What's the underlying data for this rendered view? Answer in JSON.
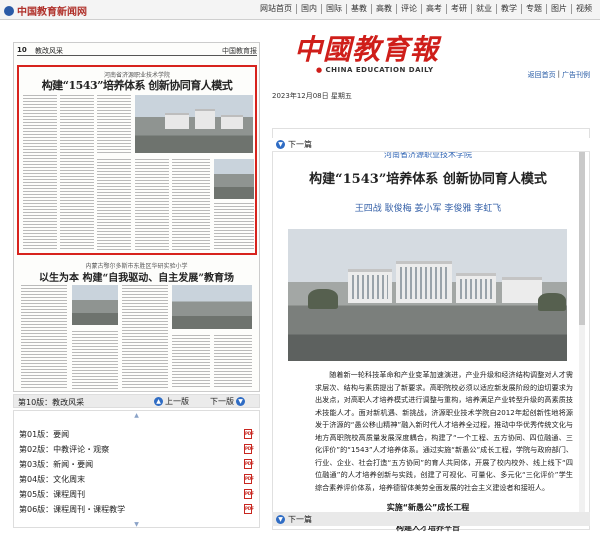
{
  "site": {
    "logo_text": "中国教育新闻网"
  },
  "nav": {
    "items": [
      "网站首页",
      "国内",
      "国际",
      "基教",
      "高教",
      "评论",
      "高考",
      "考研",
      "就业",
      "教学",
      "专题",
      "图片",
      "视频"
    ]
  },
  "paper_thumb": {
    "page_num": "10",
    "section": "教改风采",
    "brand": "中国教育报",
    "article1_pre": "河南省济源职业技术学院",
    "article1_title": "构建“1543”培养体系  创新协同育人模式",
    "article2_pre": "内蒙古鄂尔多斯市东胜区华研实验小学",
    "article2_title": "以生为本  构建“自我驱动、自主发展”教育场"
  },
  "current_page": {
    "label": "第10版：教改风采",
    "prev": "上一版",
    "next": "下一版"
  },
  "page_list": [
    {
      "label": "第01版：要闻"
    },
    {
      "label": "第02版：中教评论・观察"
    },
    {
      "label": "第03版：新闻・要闻"
    },
    {
      "label": "第04版：文化周末"
    },
    {
      "label": "第05版：课程周刊"
    },
    {
      "label": "第06版：课程周刊・课程教学"
    }
  ],
  "masthead": {
    "cn": "中國教育報",
    "en": "CHINA EDUCATION DAILY"
  },
  "top_links": {
    "home": "返回首页",
    "ad": "广告刊例",
    "sep": "|"
  },
  "date": "2023年12月08日 星期五",
  "next_article": "下一篇",
  "article": {
    "pre_title": "河南省济源职业技术学院",
    "title": "构建“1543”培养体系  创新协同育人模式",
    "authors": "王四战  耿俊梅  姜小军  李俊雅  李虹飞",
    "body": "随着新一轮科技革命和产业变革加速演进，产业升级和经济结构调整对人才需求层次、结构与素质提出了新要求。高职院校必须以适应新发展阶段的迫切要求为出发点，对高职人才培养模式进行调整与重构，培养满足产业转型升级的高素质技术技能人才。面对新机遇、新挑战，济源职业技术学院自2012年起创新性地将源发于济源的“愚公移山精神”融入新时代人才培养全过程，推动中华优秀传统文化与地方高职院校高质量发展深度耦合，构建了“一个工程、五方协同、四位融通、三化评价”的“1543”人才培养体系。通过实施“新愚公”成长工程，学院与政府部门、行业、企业、社会打造“五方协同”的育人共同体，开展了校内校外、线上线下“四位融通”的人才培养创新与实践，创建了可视化、可量化、多元化“三化评价”学生综合素养评价体系，培养德智体美劳全面发展的社会主义建设者和接班人。",
    "sub1": "实施“新愚公”成长工程",
    "sub2": "构建人才培养平台"
  }
}
